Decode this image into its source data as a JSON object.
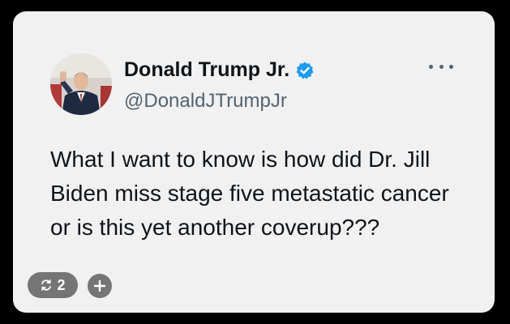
{
  "tweet": {
    "author_name": "Donald Trump Jr.",
    "handle": "@DonaldJTrumpJr",
    "verified": true,
    "text": "What I want to know is how did Dr. Jill Biden miss stage five metastatic cancer or is this yet another coverup???",
    "more_icon": "more-horizontal-icon"
  },
  "overlay": {
    "repost_count": "2",
    "repost_icon": "repost-icon",
    "add_icon": "plus-icon"
  },
  "colors": {
    "background": "#000000",
    "card": "#f1f1f1",
    "text": "#0f1419",
    "secondary_text": "#536471",
    "verified_badge": "#1d9bf0",
    "pill": "#757575"
  }
}
